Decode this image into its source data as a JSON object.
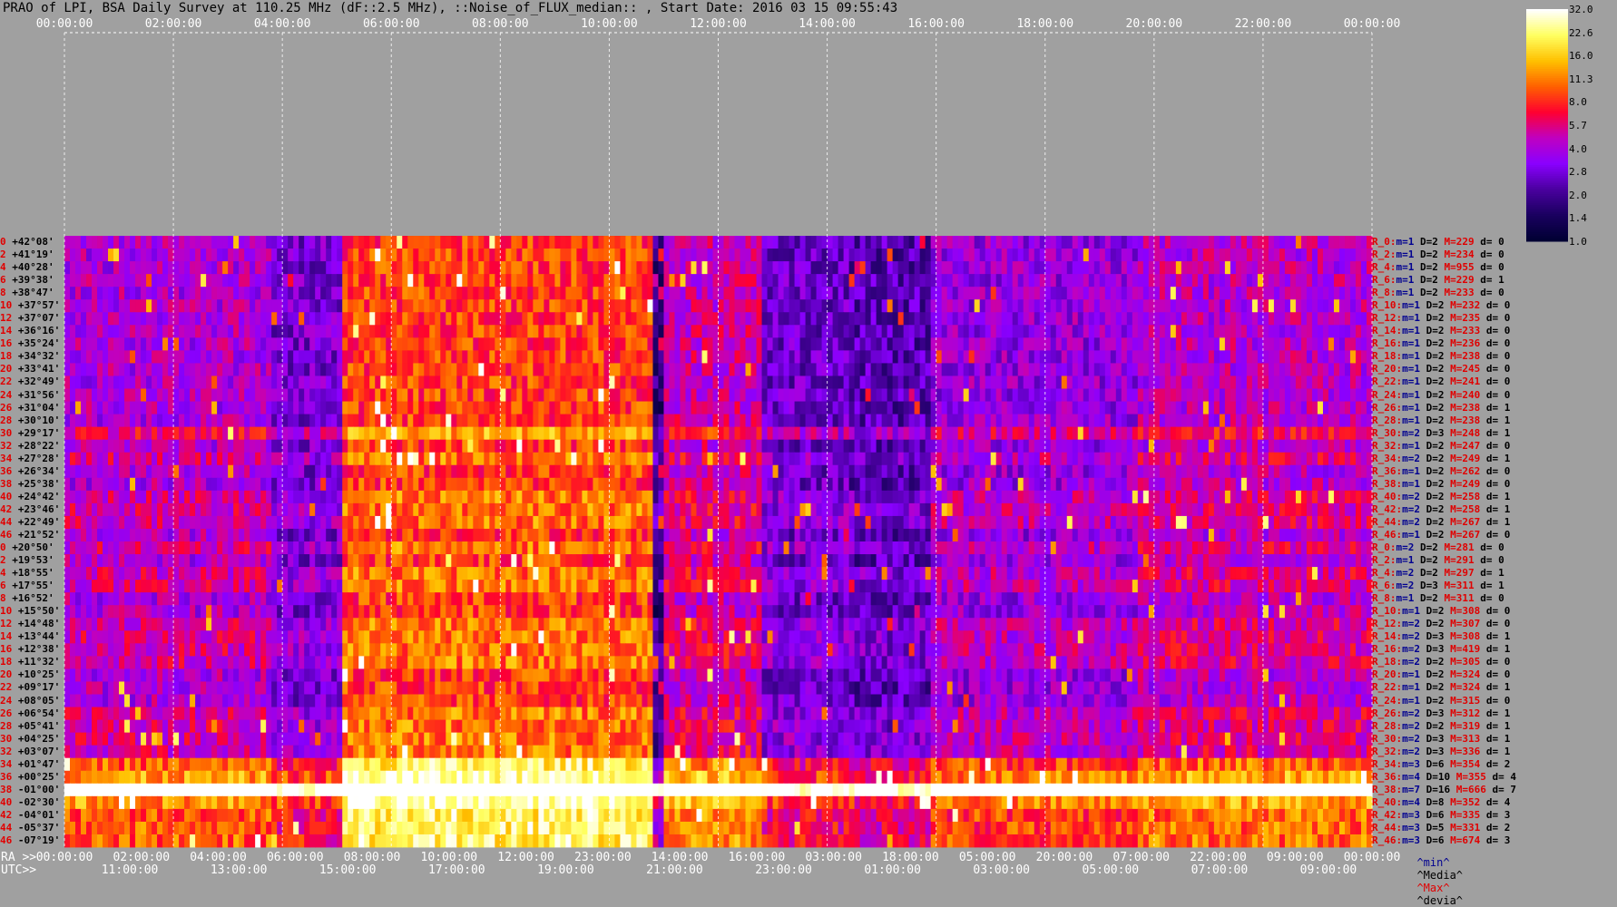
{
  "title": "PRAO of LPI, BSA Daily Survey at 110.25 MHz (dF::2.5 MHz), ::Noise_of_FLUX_median:: , Start Date: 2016 03 15 09:55:43",
  "chart_data": {
    "type": "heatmap",
    "title": "PRAO of LPI, BSA Daily Survey at 110.25 MHz (dF::2.5 MHz), ::Noise_of_FLUX_median:: , Start Date: 2016 03 15 09:55:43",
    "top_axis_ticks": [
      "00:00:00",
      "02:00:00",
      "04:00:00",
      "06:00:00",
      "08:00:00",
      "10:00:00",
      "12:00:00",
      "14:00:00",
      "16:00:00",
      "18:00:00",
      "20:00:00",
      "22:00:00",
      "00:00:00"
    ],
    "ra_axis_ticks": [
      "00:00:00",
      "02:00:00",
      "04:00:00",
      "06:00:00",
      "08:00:00",
      "10:00:00",
      "12:00:00",
      "23:00:00",
      "14:00:00",
      "16:00:00",
      "03:00:00",
      "18:00:00",
      "05:00:00",
      "20:00:00",
      "07:00:00",
      "22:00:00",
      "09:00:00",
      "00:00:00"
    ],
    "utc_axis_ticks": [
      "11:00:00",
      "13:00:00",
      "15:00:00",
      "17:00:00",
      "19:00:00",
      "21:00:00",
      "23:00:00",
      "01:00:00",
      "03:00:00",
      "05:00:00",
      "07:00:00",
      "09:00:00"
    ],
    "ra_axis_label": "RA >>",
    "utc_axis_label": "UTC>>",
    "declinations": [
      "+42°08'",
      "+41°19'",
      "+40°28'",
      "+39°38'",
      "+38°47'",
      "+37°57'",
      "+37°07'",
      "+36°16'",
      "+35°24'",
      "+34°32'",
      "+33°41'",
      "+32°49'",
      "+31°56'",
      "+31°04'",
      "+30°10'",
      "+29°17'",
      "+28°22'",
      "+27°28'",
      "+26°34'",
      "+25°38'",
      "+24°42'",
      "+23°46'",
      "+22°49'",
      "+21°52'",
      "+20°50'",
      "+19°53'",
      "+18°55'",
      "+17°55'",
      "+16°52'",
      "+15°50'",
      "+14°48'",
      "+13°44'",
      "+12°38'",
      "+11°32'",
      "+10°25'",
      "+09°17'",
      "+08°05'",
      "+06°54'",
      "+05°41'",
      "+04°25'",
      "+03°07'",
      "+01°47'",
      "+00°25'",
      "-01°00'",
      "-02°30'",
      "-04°01'",
      "-05°37'",
      "-07°19'"
    ],
    "row_indices": [
      "0",
      "2",
      "4",
      "6",
      "8",
      "10",
      "12",
      "14",
      "16",
      "18",
      "20",
      "22",
      "24",
      "26",
      "28",
      "30",
      "32",
      "34",
      "36",
      "38",
      "40",
      "42",
      "44",
      "46",
      "0",
      "2",
      "4",
      "6",
      "8",
      "10",
      "12",
      "14",
      "16",
      "18",
      "20",
      "22",
      "24",
      "26",
      "28",
      "30",
      "32",
      "34",
      "36",
      "38",
      "40",
      "42",
      "44",
      "46"
    ],
    "row_stats": [
      {
        "r": "R_0:",
        "m": "1",
        "D": "2",
        "M": "229",
        "d": "0"
      },
      {
        "r": "R_2:",
        "m": "1",
        "D": "2",
        "M": "234",
        "d": "0"
      },
      {
        "r": "R_4:",
        "m": "1",
        "D": "2",
        "M": "955",
        "d": "0"
      },
      {
        "r": "R_6:",
        "m": "1",
        "D": "2",
        "M": "229",
        "d": "1"
      },
      {
        "r": "R_8:",
        "m": "1",
        "D": "2",
        "M": "233",
        "d": "0"
      },
      {
        "r": "R_10:",
        "m": "1",
        "D": "2",
        "M": "232",
        "d": "0"
      },
      {
        "r": "R_12:",
        "m": "1",
        "D": "2",
        "M": "235",
        "d": "0"
      },
      {
        "r": "R_14:",
        "m": "1",
        "D": "2",
        "M": "233",
        "d": "0"
      },
      {
        "r": "R_16:",
        "m": "1",
        "D": "2",
        "M": "236",
        "d": "0"
      },
      {
        "r": "R_18:",
        "m": "1",
        "D": "2",
        "M": "238",
        "d": "0"
      },
      {
        "r": "R_20:",
        "m": "1",
        "D": "2",
        "M": "245",
        "d": "0"
      },
      {
        "r": "R_22:",
        "m": "1",
        "D": "2",
        "M": "241",
        "d": "0"
      },
      {
        "r": "R_24:",
        "m": "1",
        "D": "2",
        "M": "240",
        "d": "0"
      },
      {
        "r": "R_26:",
        "m": "1",
        "D": "2",
        "M": "238",
        "d": "1"
      },
      {
        "r": "R_28:",
        "m": "1",
        "D": "2",
        "M": "238",
        "d": "1"
      },
      {
        "r": "R_30:",
        "m": "2",
        "D": "3",
        "M": "248",
        "d": "1"
      },
      {
        "r": "R_32:",
        "m": "1",
        "D": "2",
        "M": "247",
        "d": "0"
      },
      {
        "r": "R_34:",
        "m": "2",
        "D": "2",
        "M": "249",
        "d": "1"
      },
      {
        "r": "R_36:",
        "m": "1",
        "D": "2",
        "M": "262",
        "d": "0"
      },
      {
        "r": "R_38:",
        "m": "1",
        "D": "2",
        "M": "249",
        "d": "0"
      },
      {
        "r": "R_40:",
        "m": "2",
        "D": "2",
        "M": "258",
        "d": "1"
      },
      {
        "r": "R_42:",
        "m": "2",
        "D": "2",
        "M": "258",
        "d": "1"
      },
      {
        "r": "R_44:",
        "m": "2",
        "D": "2",
        "M": "267",
        "d": "1"
      },
      {
        "r": "R_46:",
        "m": "1",
        "D": "2",
        "M": "267",
        "d": "0"
      },
      {
        "r": "R_0:",
        "m": "2",
        "D": "2",
        "M": "281",
        "d": "0"
      },
      {
        "r": "R_2:",
        "m": "1",
        "D": "2",
        "M": "291",
        "d": "0"
      },
      {
        "r": "R_4:",
        "m": "2",
        "D": "2",
        "M": "297",
        "d": "1"
      },
      {
        "r": "R_6:",
        "m": "2",
        "D": "3",
        "M": "311",
        "d": "1"
      },
      {
        "r": "R_8:",
        "m": "1",
        "D": "2",
        "M": "311",
        "d": "0"
      },
      {
        "r": "R_10:",
        "m": "1",
        "D": "2",
        "M": "308",
        "d": "0"
      },
      {
        "r": "R_12:",
        "m": "2",
        "D": "2",
        "M": "307",
        "d": "0"
      },
      {
        "r": "R_14:",
        "m": "2",
        "D": "3",
        "M": "308",
        "d": "1"
      },
      {
        "r": "R_16:",
        "m": "2",
        "D": "3",
        "M": "419",
        "d": "1"
      },
      {
        "r": "R_18:",
        "m": "2",
        "D": "2",
        "M": "305",
        "d": "0"
      },
      {
        "r": "R_20:",
        "m": "1",
        "D": "2",
        "M": "324",
        "d": "0"
      },
      {
        "r": "R_22:",
        "m": "1",
        "D": "2",
        "M": "324",
        "d": "1"
      },
      {
        "r": "R_24:",
        "m": "1",
        "D": "2",
        "M": "315",
        "d": "0"
      },
      {
        "r": "R_26:",
        "m": "2",
        "D": "3",
        "M": "312",
        "d": "1"
      },
      {
        "r": "R_28:",
        "m": "2",
        "D": "2",
        "M": "319",
        "d": "1"
      },
      {
        "r": "R_30:",
        "m": "2",
        "D": "3",
        "M": "313",
        "d": "1"
      },
      {
        "r": "R_32:",
        "m": "2",
        "D": "3",
        "M": "336",
        "d": "1"
      },
      {
        "r": "R_34:",
        "m": "3",
        "D": "6",
        "M": "354",
        "d": "2"
      },
      {
        "r": "R_36:",
        "m": "4",
        "D": "10",
        "M": "355",
        "d": "4"
      },
      {
        "r": "R_38:",
        "m": "7",
        "D": "16",
        "M": "666",
        "d": "7"
      },
      {
        "r": "R_40:",
        "m": "4",
        "D": "8",
        "M": "352",
        "d": "4"
      },
      {
        "r": "R_42:",
        "m": "3",
        "D": "6",
        "M": "335",
        "d": "3"
      },
      {
        "r": "R_44:",
        "m": "3",
        "D": "5",
        "M": "331",
        "d": "2"
      },
      {
        "r": "R_46:",
        "m": "3",
        "D": "6",
        "M": "674",
        "d": "3"
      }
    ],
    "colorbar_ticks": [
      "32.0",
      "22.6",
      "16.0",
      "11.3",
      "8.0",
      "5.7",
      "4.0",
      "2.8",
      "2.0",
      "1.4",
      "1.0"
    ],
    "colorbar_range": [
      1.0,
      32.0
    ],
    "colorbar_scale": "log",
    "colormap": [
      "#000033",
      "#1a0060",
      "#4b00a0",
      "#8a00ff",
      "#c000c0",
      "#ff0030",
      "#ff6000",
      "#ffc000",
      "#ffff60",
      "#ffffff"
    ],
    "stats_legend": {
      "min": "^min^",
      "median": "^Media^",
      "max": "^Max^",
      "dev": "^devia^"
    },
    "stats_colors": {
      "min": "#000090",
      "median": "#000000",
      "max": "#e00000",
      "dev": "#000000"
    },
    "grid": true
  }
}
